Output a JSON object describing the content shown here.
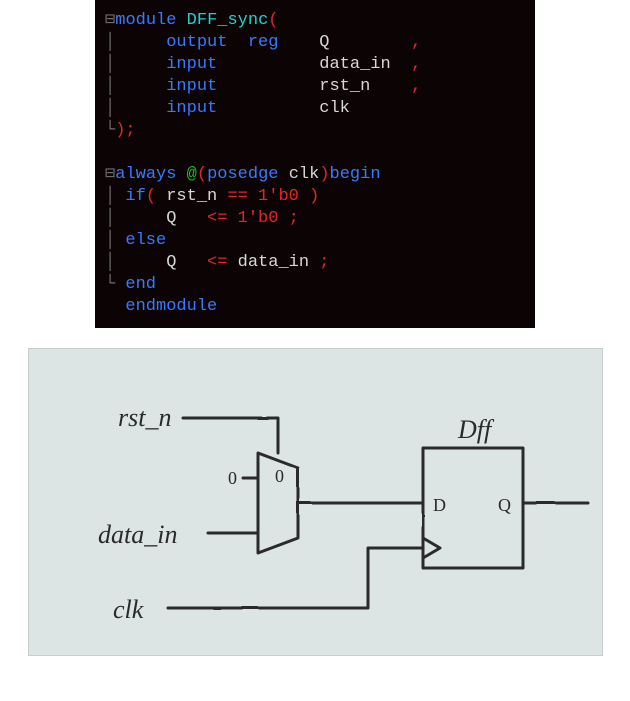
{
  "code": {
    "module_kw": "module",
    "module_name": "DFF_sync",
    "lparen": "(",
    "rparen": ")",
    "semi": ";",
    "comma": ",",
    "decl_output": "output",
    "decl_reg": "reg",
    "decl_input": "input",
    "port_Q": "Q",
    "port_data_in": "data_in",
    "port_rst_n": "rst_n",
    "port_clk": "clk",
    "always_kw": "always",
    "at": "@",
    "posedge_kw": "posedge",
    "begin_kw": "begin",
    "if_kw": "if",
    "eq_op": "==",
    "lit_1b0": "1'b0",
    "nb_assign": "<=",
    "else_kw": "else",
    "end_kw": "end",
    "endmodule_kw": "endmodule"
  },
  "diagram": {
    "label_rst_n": "rst_n",
    "label_data_in": "data_in",
    "label_clk": "clk",
    "label_dff": "Dff",
    "label_zero_top": "0",
    "label_zero_sel": "0",
    "label_D": "D",
    "label_Q": "Q"
  }
}
